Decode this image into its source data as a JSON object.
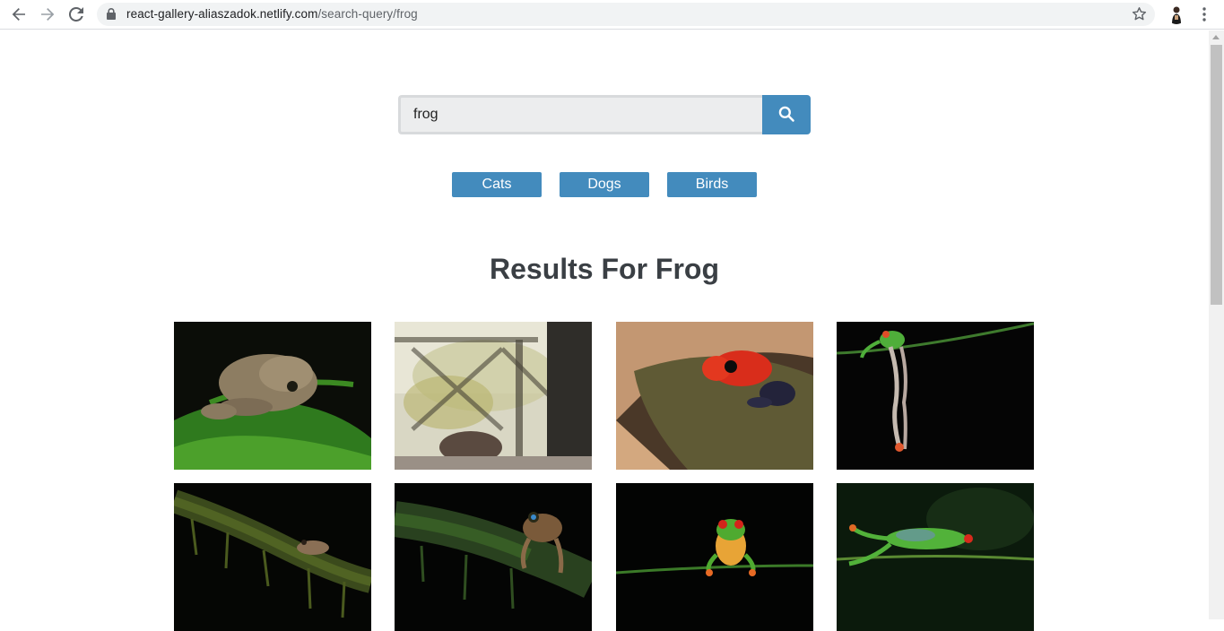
{
  "browser": {
    "url_host": "react-gallery-aliaszadok.netlify.com",
    "url_path": "/search-query/frog",
    "icons": [
      "back-icon",
      "forward-icon",
      "reload-icon",
      "lock-icon",
      "star-icon",
      "profile-avatar",
      "menu-icon"
    ]
  },
  "search": {
    "value": "frog",
    "button_icon": "search-icon"
  },
  "nav": {
    "links": [
      "Cats",
      "Dogs",
      "Birds"
    ]
  },
  "results": {
    "title": "Results For Frog"
  },
  "gallery": {
    "photos": [
      {
        "subject": "brown frog on green leaf"
      },
      {
        "subject": "blurred window scene"
      },
      {
        "subject": "red poison dart frog on leaf"
      },
      {
        "subject": "tree frog hanging from stem"
      },
      {
        "subject": "small frog on mossy branch"
      },
      {
        "subject": "tree frog climbing mossy branch"
      },
      {
        "subject": "red-eyed tree frog on stem"
      },
      {
        "subject": "green tree frog on vine"
      }
    ]
  },
  "colors": {
    "accent": "#438bbd",
    "title_text": "#3a3f44",
    "input_bg": "#ecedee"
  }
}
